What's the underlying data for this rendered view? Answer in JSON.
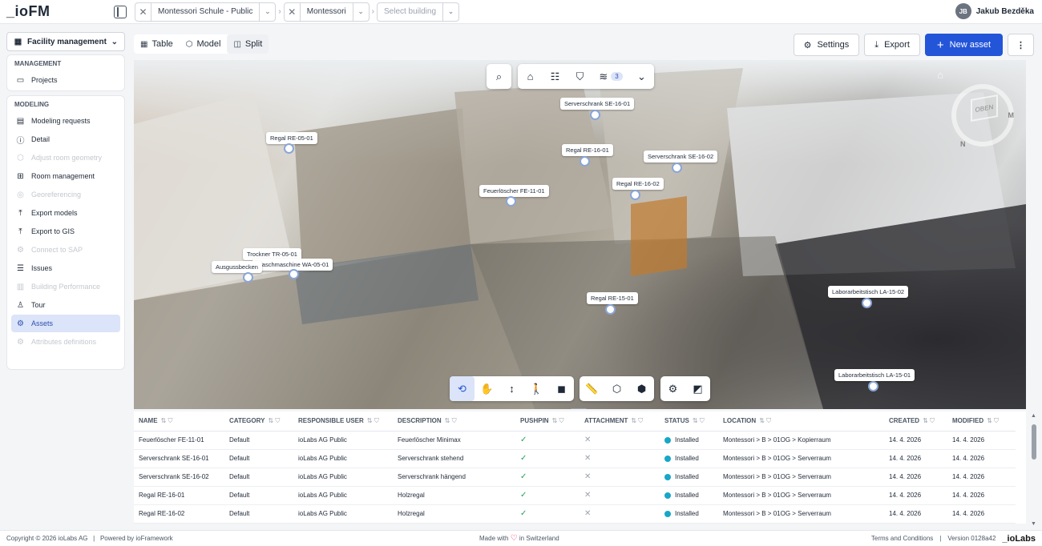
{
  "app": {
    "logo": "_ioFM"
  },
  "breadcrumbs": {
    "site": "Montessori Schule - Public",
    "building_group": "Montessori",
    "building_placeholder": "Select building"
  },
  "user": {
    "initials": "JB",
    "name": "Jakub Bezděka"
  },
  "sidebar": {
    "module": "Facility management",
    "management_title": "MANAGEMENT",
    "management_items": [
      {
        "label": "Projects",
        "icon": "folder-icon"
      }
    ],
    "modeling_title": "MODELING",
    "modeling_items": [
      {
        "label": "Modeling requests",
        "icon": "document-icon",
        "state": "enabled"
      },
      {
        "label": "Detail",
        "icon": "info-icon",
        "state": "enabled"
      },
      {
        "label": "Adjust room geometry",
        "icon": "cube-icon",
        "state": "disabled"
      },
      {
        "label": "Room management",
        "icon": "rooms-icon",
        "state": "enabled"
      },
      {
        "label": "Georeferencing",
        "icon": "location-icon",
        "state": "disabled"
      },
      {
        "label": "Export models",
        "icon": "upload-icon",
        "state": "enabled"
      },
      {
        "label": "Export to GIS",
        "icon": "upload-icon",
        "state": "enabled"
      },
      {
        "label": "Connect to SAP",
        "icon": "gear-icon",
        "state": "disabled"
      },
      {
        "label": "Issues",
        "icon": "ticket-icon",
        "state": "enabled"
      },
      {
        "label": "Building Performance",
        "icon": "chart-icon",
        "state": "disabled"
      },
      {
        "label": "Tour",
        "icon": "person-icon",
        "state": "enabled"
      },
      {
        "label": "Assets",
        "icon": "assets-icon",
        "state": "active"
      },
      {
        "label": "Attributes definitions",
        "icon": "gear-icon",
        "state": "disabled"
      }
    ]
  },
  "view_tabs": [
    {
      "label": "Table",
      "active": false
    },
    {
      "label": "Model",
      "active": false
    },
    {
      "label": "Split",
      "active": true
    }
  ],
  "actions": {
    "settings": "Settings",
    "export": "Export",
    "new_asset": "New asset",
    "more": "⋮"
  },
  "viewer": {
    "layers_count": "3",
    "pins": [
      {
        "label": "Serverschrank SE-16-01"
      },
      {
        "label": "Regal RE-05-01"
      },
      {
        "label": "Regal RE-16-01"
      },
      {
        "label": "Serverschrank SE-16-02"
      },
      {
        "label": "Regal RE-16-02"
      },
      {
        "label": "Feuerlöscher FE-11-01"
      },
      {
        "label": "Trockner TR-05-01"
      },
      {
        "label": "Waschmaschine WA-05-01"
      },
      {
        "label": "Ausgussbecken"
      },
      {
        "label": "Regal RE-15-01"
      },
      {
        "label": "Laborarbeitstisch LA-15-02"
      },
      {
        "label": "Laborarbeitstisch LA-15-01"
      }
    ],
    "compass_label": "OBEN",
    "compass_n": "N",
    "compass_m": "M"
  },
  "table": {
    "columns": [
      "NAME",
      "CATEGORY",
      "RESPONSIBLE USER",
      "DESCRIPTION",
      "PUSHPIN",
      "ATTACHMENT",
      "STATUS",
      "LOCATION",
      "CREATED",
      "MODIFIED"
    ],
    "rows": [
      {
        "name": "Feuerlöscher FE-11-01",
        "category": "Default",
        "user": "ioLabs AG Public",
        "description": "Feuerlöscher Minimax",
        "pushpin": "✓",
        "attachment": "✕",
        "status": "Installed",
        "location": "Montessori > B > 01OG > Kopierraum",
        "created": "14. 4. 2026",
        "modified": "14. 4. 2026"
      },
      {
        "name": "Serverschrank SE-16-01",
        "category": "Default",
        "user": "ioLabs AG Public",
        "description": "Serverschrank stehend",
        "pushpin": "✓",
        "attachment": "✕",
        "status": "Installed",
        "location": "Montessori > B > 01OG > Serverraum",
        "created": "14. 4. 2026",
        "modified": "14. 4. 2026"
      },
      {
        "name": "Serverschrank SE-16-02",
        "category": "Default",
        "user": "ioLabs AG Public",
        "description": "Serverschrank hängend",
        "pushpin": "✓",
        "attachment": "✕",
        "status": "Installed",
        "location": "Montessori > B > 01OG > Serverraum",
        "created": "14. 4. 2026",
        "modified": "14. 4. 2026"
      },
      {
        "name": "Regal RE-16-01",
        "category": "Default",
        "user": "ioLabs AG Public",
        "description": "Holzregal",
        "pushpin": "✓",
        "attachment": "✕",
        "status": "Installed",
        "location": "Montessori > B > 01OG > Serverraum",
        "created": "14. 4. 2026",
        "modified": "14. 4. 2026"
      },
      {
        "name": "Regal RE-16-02",
        "category": "Default",
        "user": "ioLabs AG Public",
        "description": "Holzregal",
        "pushpin": "✓",
        "attachment": "✕",
        "status": "Installed",
        "location": "Montessori > B > 01OG > Serverraum",
        "created": "14. 4. 2026",
        "modified": "14. 4. 2026"
      }
    ]
  },
  "footer": {
    "copyright": "Copyright © 2026 ioLabs AG",
    "powered": "Powered by ioFramework",
    "made_with": "Made with",
    "made_in": "in Switzerland",
    "terms": "Terms and Conditions",
    "version": "Version 0128a42",
    "brand": "_ioLabs"
  },
  "colors": {
    "primary": "#2355d9",
    "active_bg": "#dbe4f8",
    "status_installed": "#17a7c8",
    "check": "#22a05a"
  }
}
